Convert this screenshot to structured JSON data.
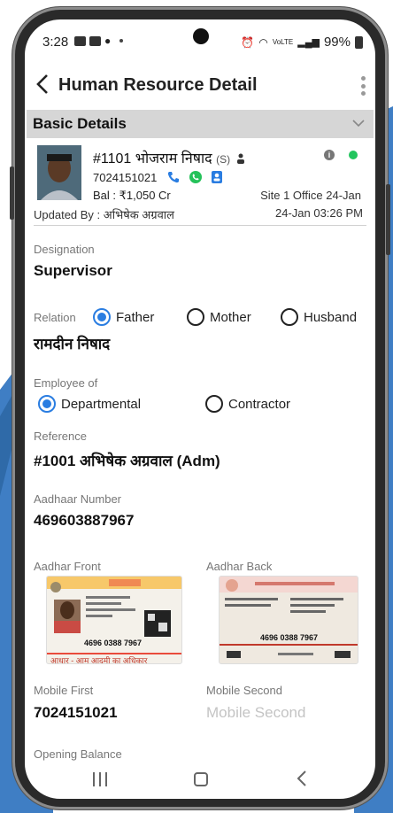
{
  "status_bar": {
    "time": "3:28",
    "battery": "99%"
  },
  "header": {
    "title": "Human Resource Detail"
  },
  "section": {
    "title": "Basic Details"
  },
  "employee": {
    "name": "#1101 भोजराम निषाद",
    "tag": "(S)",
    "phone": "7024151021",
    "balance": "Bal : ₹1,050 Cr",
    "site": "Site 1 Office 24-Jan",
    "updated_by": "Updated By : अभिषेक अग्रवाल",
    "updated_at": "24-Jan 03:26 PM",
    "status_color": "#22c55e"
  },
  "fields": {
    "designation_label": "Designation",
    "designation_value": "Supervisor",
    "relation_label": "Relation",
    "relation_options": [
      "Father",
      "Mother",
      "Husband"
    ],
    "relation_selected": "Father",
    "relation_value": "रामदीन निषाद",
    "employee_of_label": "Employee of",
    "employee_of_options": [
      "Departmental",
      "Contractor"
    ],
    "employee_of_selected": "Departmental",
    "reference_label": "Reference",
    "reference_value": "#1001 अभिषेक अग्रवाल (Adm)",
    "aadhaar_label": "Aadhaar Number",
    "aadhaar_value": "469603887967",
    "aadhar_front_label": "Aadhar Front",
    "aadhar_back_label": "Aadhar Back",
    "aadhar_card_number": "4696 0388 7967",
    "aadhar_front_footer": "आधार - आम आदमी का अधिकार",
    "mobile_first_label": "Mobile First",
    "mobile_first_value": "7024151021",
    "mobile_second_label": "Mobile Second",
    "mobile_second_placeholder": "Mobile Second",
    "opening_balance_label": "Opening Balance"
  },
  "colors": {
    "accent": "#2a7de1",
    "section_bg": "#d6d6d6",
    "backdrop": "#3f7ec4"
  }
}
